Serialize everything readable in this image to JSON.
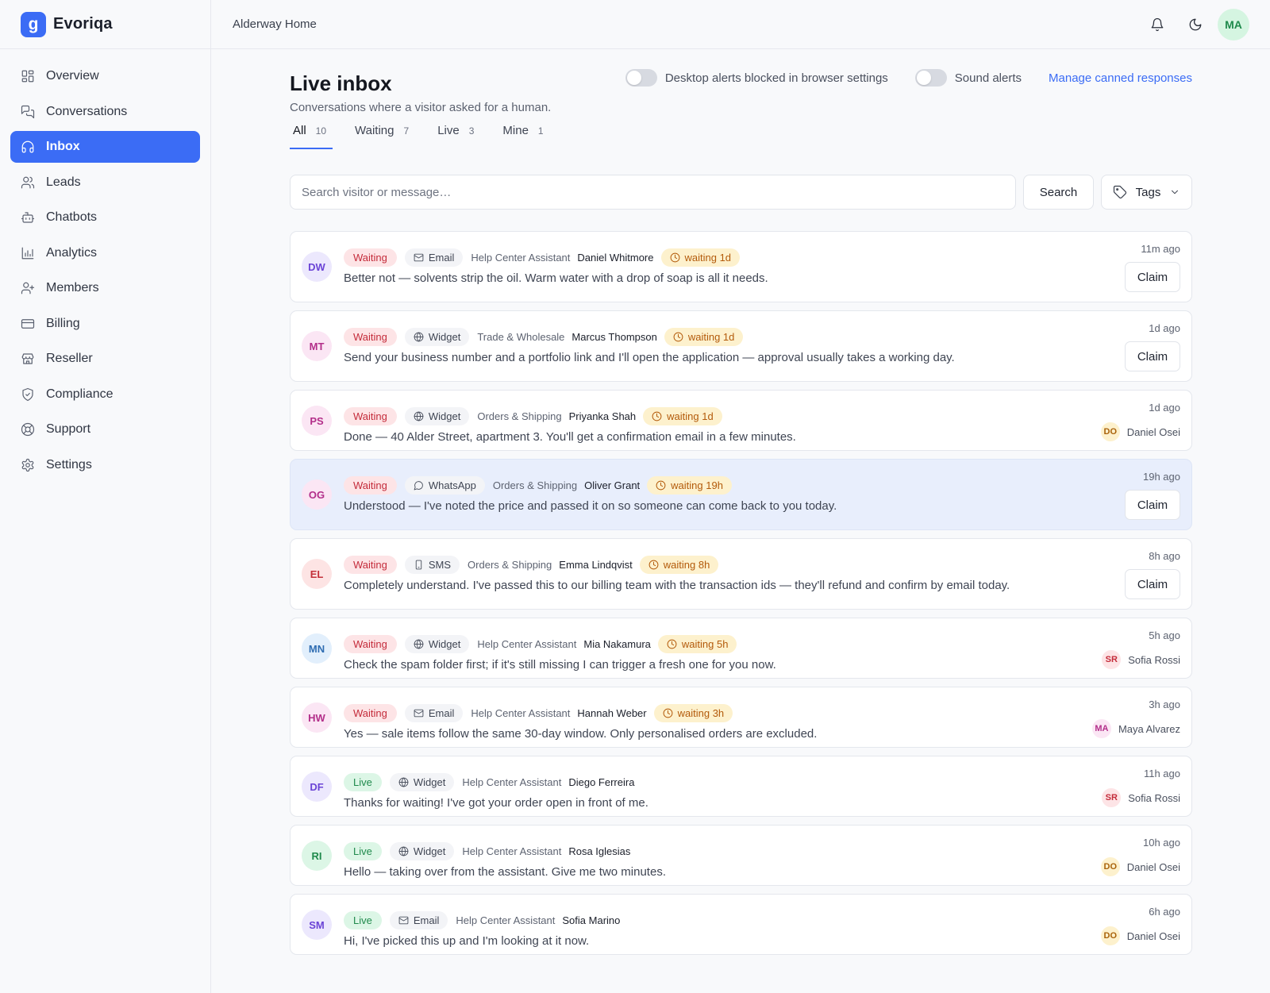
{
  "app": {
    "name": "Evoriqa",
    "logo_letter": "g",
    "workspace": "Alderway Home",
    "accent": "#3b6cf5"
  },
  "user": {
    "initials": "MA"
  },
  "nav": [
    {
      "label": "Overview",
      "icon": "overview-icon"
    },
    {
      "label": "Conversations",
      "icon": "conversations-icon"
    },
    {
      "label": "Inbox",
      "icon": "headset-icon",
      "active": true
    },
    {
      "label": "Leads",
      "icon": "users-icon"
    },
    {
      "label": "Chatbots",
      "icon": "bot-icon"
    },
    {
      "label": "Analytics",
      "icon": "chart-icon"
    },
    {
      "label": "Members",
      "icon": "user-plus-icon"
    },
    {
      "label": "Billing",
      "icon": "card-icon"
    },
    {
      "label": "Reseller",
      "icon": "store-icon"
    },
    {
      "label": "Compliance",
      "icon": "shield-icon"
    },
    {
      "label": "Support",
      "icon": "lifebuoy-icon"
    },
    {
      "label": "Settings",
      "icon": "gear-icon"
    }
  ],
  "page": {
    "title": "Live inbox",
    "subtitle": "Conversations where a visitor asked for a human.",
    "desktop_alerts_label": "Desktop alerts blocked in browser settings",
    "sound_alerts_label": "Sound alerts",
    "manage_link": "Manage canned responses"
  },
  "tabs": [
    {
      "label": "All",
      "count": "10"
    },
    {
      "label": "Waiting",
      "count": "7"
    },
    {
      "label": "Live",
      "count": "3"
    },
    {
      "label": "Mine",
      "count": "1"
    }
  ],
  "search": {
    "placeholder": "Search visitor or message…",
    "button": "Search",
    "tags": "Tags"
  },
  "claim_label": "Claim",
  "conversations": [
    {
      "initials": "DW",
      "status": "Waiting",
      "channel": "Email",
      "bot": "Help Center Assistant",
      "visitor": "Daniel Whitmore",
      "waiting": "waiting 1d",
      "message": "Better not — solvents strip the oil. Warm water with a drop of soap is all it needs.",
      "time": "11m ago"
    },
    {
      "initials": "MT",
      "status": "Waiting",
      "channel": "Widget",
      "bot": "Trade & Wholesale",
      "visitor": "Marcus Thompson",
      "waiting": "waiting 1d",
      "message": "Send your business number and a portfolio link and I'll open the application — approval usually takes a working day.",
      "time": "1d ago"
    },
    {
      "initials": "PS",
      "status": "Waiting",
      "channel": "Widget",
      "bot": "Orders & Shipping",
      "visitor": "Priyanka Shah",
      "waiting": "waiting 1d",
      "message": "Done — 40 Alder Street, apartment 3. You'll get a confirmation email in a few minutes.",
      "time": "1d ago",
      "assignee": {
        "initials": "DO",
        "name": "Daniel Osei"
      }
    },
    {
      "initials": "OG",
      "status": "Waiting",
      "channel": "WhatsApp",
      "bot": "Orders & Shipping",
      "visitor": "Oliver Grant",
      "waiting": "waiting 19h",
      "message": "Understood — I've noted the price and passed it on so someone can come back to you today.",
      "time": "19h ago",
      "highlight": true
    },
    {
      "initials": "EL",
      "status": "Waiting",
      "channel": "SMS",
      "bot": "Orders & Shipping",
      "visitor": "Emma Lindqvist",
      "waiting": "waiting 8h",
      "message": "Completely understand. I've passed this to our billing team with the transaction ids — they'll refund and confirm by email today.",
      "time": "8h ago"
    },
    {
      "initials": "MN",
      "status": "Waiting",
      "channel": "Widget",
      "bot": "Help Center Assistant",
      "visitor": "Mia Nakamura",
      "waiting": "waiting 5h",
      "message": "Check the spam folder first; if it's still missing I can trigger a fresh one for you now.",
      "time": "5h ago",
      "assignee": {
        "initials": "SR",
        "name": "Sofia Rossi"
      }
    },
    {
      "initials": "HW",
      "status": "Waiting",
      "channel": "Email",
      "bot": "Help Center Assistant",
      "visitor": "Hannah Weber",
      "waiting": "waiting 3h",
      "message": "Yes — sale items follow the same 30-day window. Only personalised orders are excluded.",
      "time": "3h ago",
      "assignee": {
        "initials": "MA",
        "name": "Maya Alvarez"
      }
    },
    {
      "initials": "DF",
      "status": "Live",
      "channel": "Widget",
      "bot": "Help Center Assistant",
      "visitor": "Diego Ferreira",
      "message": "Thanks for waiting! I've got your order open in front of me.",
      "time": "11h ago",
      "assignee": {
        "initials": "SR",
        "name": "Sofia Rossi"
      }
    },
    {
      "initials": "RI",
      "status": "Live",
      "channel": "Widget",
      "bot": "Help Center Assistant",
      "visitor": "Rosa Iglesias",
      "message": "Hello — taking over from the assistant. Give me two minutes.",
      "time": "10h ago",
      "assignee": {
        "initials": "DO",
        "name": "Daniel Osei"
      }
    },
    {
      "initials": "SM",
      "status": "Live",
      "channel": "Email",
      "bot": "Help Center Assistant",
      "visitor": "Sofia Marino",
      "message": "Hi, I've picked this up and I'm looking at it now.",
      "time": "6h ago",
      "assignee": {
        "initials": "DO",
        "name": "Daniel Osei"
      }
    }
  ]
}
